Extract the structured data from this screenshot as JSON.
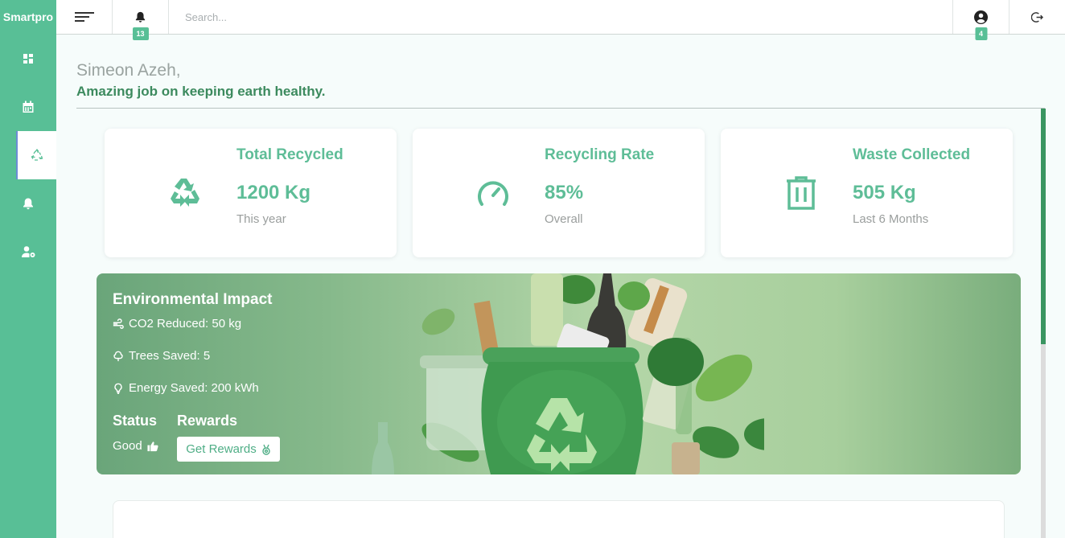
{
  "app": {
    "brand": "Smartpro"
  },
  "sidebar": {
    "items": [
      {
        "name": "dashboard",
        "icon": "grid-icon"
      },
      {
        "name": "schedule",
        "icon": "calendar-icon"
      },
      {
        "name": "recycle",
        "icon": "recycle-icon",
        "active": true
      },
      {
        "name": "notifications",
        "icon": "bell-icon"
      },
      {
        "name": "user-settings",
        "icon": "user-gear-icon"
      }
    ]
  },
  "topbar": {
    "search_placeholder": "Search...",
    "notifications_count": "13",
    "user_count": "4"
  },
  "greeting": {
    "name": "Simeon Azeh,",
    "message": "Amazing job on keeping earth healthy."
  },
  "stats": [
    {
      "title": "Total Recycled",
      "value": "1200 Kg",
      "sub": "This year",
      "icon": "recycle-icon"
    },
    {
      "title": "Recycling Rate",
      "value": "85%",
      "sub": "Overall",
      "icon": "gauge-icon"
    },
    {
      "title": "Waste Collected",
      "value": "505 Kg",
      "sub": "Last 6 Months",
      "icon": "trash-icon"
    }
  ],
  "impact": {
    "title": "Environmental Impact",
    "co2": "CO2 Reduced: 50 kg",
    "trees": "Trees Saved: 5",
    "energy": "Energy Saved: 200 kWh",
    "status_label": "Status",
    "status_value": "Good",
    "rewards_label": "Rewards",
    "rewards_button": "Get Rewards"
  },
  "colors": {
    "accent": "#58bf96",
    "dark_green": "#3c8a5e"
  }
}
